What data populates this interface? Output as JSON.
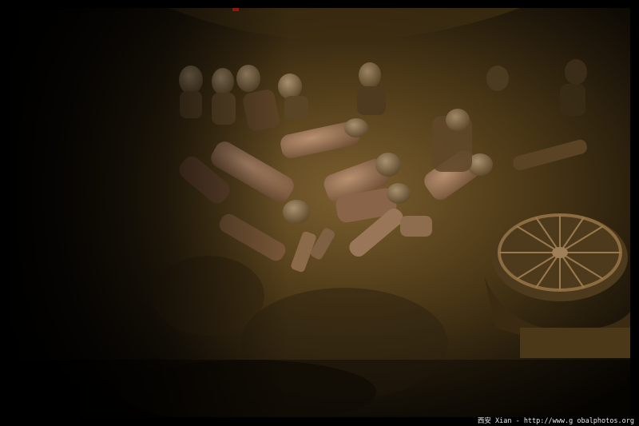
{
  "image": {
    "subject": "terracotta-figurines-excavation-pit",
    "caption": "西安 Xian - http://www.g obalphotos.org"
  },
  "colors": {
    "border": "#000000",
    "soil_light": "#8a6a35",
    "soil_dark": "#1a1206",
    "terracotta": "#a0785a",
    "caption_text": "#e8e8e8"
  }
}
